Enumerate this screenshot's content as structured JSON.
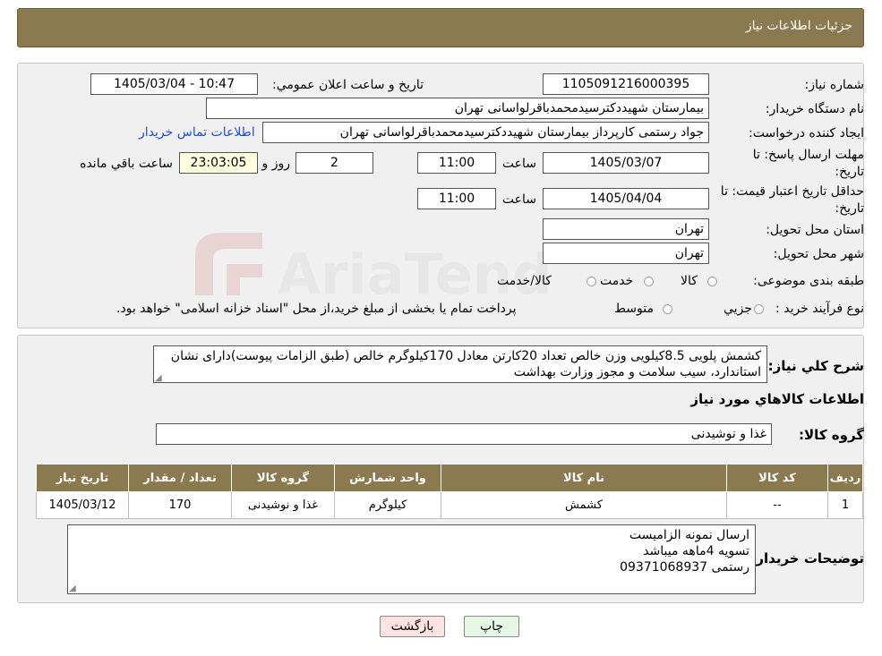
{
  "header": {
    "title": "جزئیات اطلاعات نیاز"
  },
  "form": {
    "need_number_label": "شماره نیاز:",
    "need_number": "1105091216000395",
    "announce_label": "تاریخ و ساعت اعلان عمومي:",
    "announce_value": "1405/03/04 - 10:47",
    "buyer_org_label": "نام دستگاه خريدار:",
    "buyer_org": "بیمارستان شهیددکترسیدمحمدباقرلواسانی تهران",
    "creator_label": "ايجاد كننده درخواست:",
    "creator": "جواد رستمی کارپرداز بیمارستان شهیددکترسیدمحمدباقرلواسانی تهران",
    "contact_link": "اطلاعات تماس خريدار",
    "deadline_label_1": "مهلت ارسال پاسخ: تا",
    "deadline_label_2": "تاريخ:",
    "deadline_date": "1405/03/07",
    "time_label": "ساعت",
    "deadline_time": "11:00",
    "days_value": "2",
    "days_label": "روز و",
    "remaining_value": "23:03:05",
    "remaining_label": "ساعت باقي مانده",
    "validity_label_1": "حداقل تاريخ اعتبار قيمت: تا",
    "validity_label_2": "تاريخ:",
    "validity_date": "1405/04/04",
    "validity_time": "11:00",
    "province_label": "استان محل تحويل:",
    "province": "تهران",
    "city_label": "شهر محل تحويل:",
    "city": "تهران",
    "category_label": "طبقه بندی موضوعی:",
    "category_options": [
      "كالا",
      "خدمت",
      "كالا/خدمت"
    ],
    "process_label": "نوع فرآيند خريد :",
    "process_options": [
      "جزيي",
      "متوسط"
    ],
    "process_note": "پرداخت تمام یا بخشی از مبلغ خرید،از محل \"اسناد خزانه اسلامی\" خواهد بود."
  },
  "description": {
    "label": "شرح كلي نياز:",
    "text": "کشمش پلویی 8.5کیلویی وزن خالص تعداد 20کارتن معادل 170کیلوگرم خالص (طبق الزامات پیوست)دارای نشان استاندارد، سیب سلامت و مجوز وزارت بهداشت",
    "goods_info_title": "اطلاعات كالاهاي مورد نياز",
    "group_label": "گروه كالا:",
    "group_value": "غذا و نوشیدنی"
  },
  "table": {
    "headers": [
      "رديف",
      "كد كالا",
      "نام كالا",
      "واحد شمارش",
      "گروه كالا",
      "تعداد / مقدار",
      "تاريخ نياز"
    ],
    "rows": [
      [
        "1",
        "--",
        "کشمش",
        "کیلوگرم",
        "غذا و نوشیدنی",
        "170",
        "1405/03/12"
      ]
    ]
  },
  "buyer_notes": {
    "label": "توضيحات خريدار:",
    "lines": [
      "ارسال نمونه الزامیست",
      "تسویه 4ماهه میباشد",
      "رستمی 09371068937"
    ]
  },
  "buttons": {
    "print": "چاپ",
    "back": "بازگشت"
  },
  "watermark_text": "AriaTender.neT",
  "colors": {
    "header_bg": "#8b7a4f",
    "link": "#1a4fd6",
    "back_button_bg": "#fde2e2",
    "print_button_bg": "#e6f7e6"
  }
}
